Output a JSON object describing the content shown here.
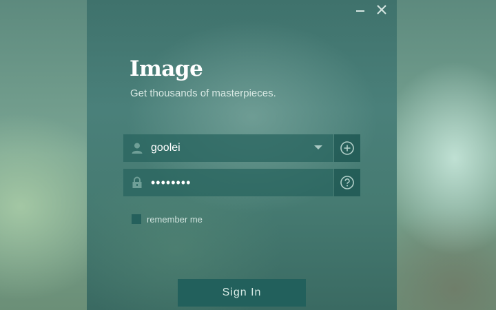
{
  "window": {
    "title": "Image",
    "subtitle": "Get thousands of masterpieces."
  },
  "controls": {
    "minimize_icon": "minimize-icon",
    "close_icon": "close-icon"
  },
  "login": {
    "username": {
      "value": "goolei",
      "icon": "user-icon",
      "side_icon": "add-circle-icon"
    },
    "password": {
      "value": "password",
      "icon": "lock-icon",
      "side_icon": "help-circle-icon"
    },
    "remember_label": "remember me",
    "remember_checked": false,
    "sign_in_label": "Sign In"
  },
  "colors": {
    "panel": "#467b72",
    "field": "#28645f",
    "button": "#22605c",
    "text": "#ffffff",
    "muted_text": "#d7e8e3"
  }
}
